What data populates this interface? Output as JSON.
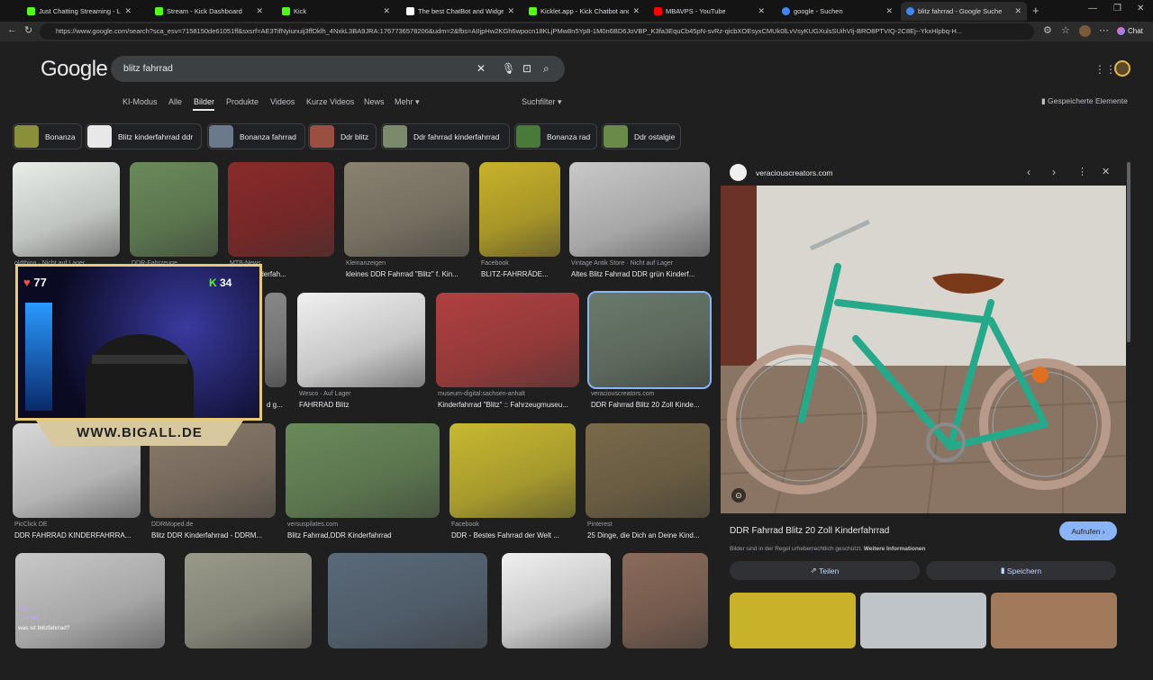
{
  "browser": {
    "tabs": [
      {
        "title": "Just Chatting Streaming - Live Stre",
        "color": "#53fc18"
      },
      {
        "title": "Stream - Kick Dashboard",
        "color": "#53fc18"
      },
      {
        "title": "Kick",
        "color": "#53fc18"
      },
      {
        "title": "The best ChatBot and Widgets fo",
        "color": "#ffffff"
      },
      {
        "title": "Kicklet.app - Kick Chatbot and Ov",
        "color": "#53fc18"
      },
      {
        "title": "MBAVPS - YouTube",
        "color": "#ff0000"
      },
      {
        "title": "google - Suchen",
        "color": "#4285f4"
      },
      {
        "title": "blitz fahrrad - Google Suche",
        "color": "#4285f4"
      }
    ],
    "url": "https://www.google.com/search?sca_esv=7158150de61051ff&sxsrf=AE3TifNyiunuij3ffDklh_4NxkL3BA9JRA:1767736578206&udm=2&fbs=AIIjpHw2KGh6wpocn18KLjPMw8n5Yp8-1M0n6BD6JoVBP_K3fa3EquCb45pN-svRz-qicbXOEsyxCMUk0lLvVsyKUGXulsSUihVIj-BRO8PTVIQ-2C8Ej--YkxHlpbq-H...",
    "chat_label": "Chat"
  },
  "google": {
    "logo": "Google",
    "query": "blitz fahrrad",
    "tabs": [
      "KI-Modus",
      "Alle",
      "Bilder",
      "Produkte",
      "Videos",
      "Kurze Videos",
      "News",
      "Mehr ▾"
    ],
    "filter": "Suchfilter ▾",
    "saved": "Gespeicherte Elemente",
    "chips": [
      {
        "label": "Bonanza",
        "color": "#8a8f3a"
      },
      {
        "label": "Blitz kinderfahrrad ddr",
        "color": "#e8e8e8"
      },
      {
        "label": "Bonanza fahrrad",
        "color": "#6b7a8a"
      },
      {
        "label": "Ddr blitz",
        "color": "#9a5040"
      },
      {
        "label": "Ddr fahrrad kinderfahrrad",
        "color": "#7a8a6a"
      },
      {
        "label": "Bonanza rad",
        "color": "#4a7a3a"
      },
      {
        "label": "Ddr ostalgie",
        "color": "#6a8a4a"
      }
    ]
  },
  "results": [
    {
      "src": "oldthing · Nicht auf Lager",
      "title": "",
      "color": "#e8ede8"
    },
    {
      "src": "DDR-Fahrzeuge",
      "title": "",
      "color": "#6a8a5a"
    },
    {
      "src": "MTB-News",
      "title": "2 Zoll Kinderfah...",
      "color": "#8a2a2a"
    },
    {
      "src": "Kleinanzeigen",
      "title": "kleines DDR Fahrrad \"Blitz\" f. Kin...",
      "color": "#8a8270"
    },
    {
      "src": "Facebook",
      "title": "BLITZ-FAHRRÄDE...",
      "color": "#c8b22a"
    },
    {
      "src": "Vintage Antik Store · Nicht auf Lager",
      "title": "Altes Blitz Fahrrad DDR grün Kinderf...",
      "color": "#c8c8c8"
    },
    {
      "src": "",
      "title": "d g...",
      "color": "#888888"
    },
    {
      "src": "Wesco · Auf Lager",
      "title": "FAHRRAD Blitz",
      "color": "#f0f0f0"
    },
    {
      "src": "museum-digital:sachsen-anhalt",
      "title": "Kinderfahrrad \"Blitz\" :: Fahrzeugmuseu...",
      "color": "#b04040"
    },
    {
      "src": "veraciouscreators.com",
      "title": "DDR Fahrrad Blitz 20 Zoll Kinde...",
      "color": "#6a7a6a"
    },
    {
      "src": "PicClick DE",
      "title": "DDR FAHRRAD KINDERFAHRRA...",
      "color": "#d8d8d8"
    },
    {
      "src": "DDRMoped.de",
      "title": "Blitz DDR Kinderfahrrad - DDRM...",
      "color": "#8a7a6a"
    },
    {
      "src": "versuspilates.com",
      "title": "Blitz Fahrrad,DDR Kinderfahrrad",
      "color": "#6a8a5a"
    },
    {
      "src": "Facebook",
      "title": "DDR - Bestes Fahrrad der Welt ...",
      "color": "#c8b830"
    },
    {
      "src": "Pinterest",
      "title": "25 Dinge, die Dich an Deine Kind...",
      "color": "#7a6a4a"
    },
    {
      "src": "",
      "title": "",
      "color": "#c8c8c8"
    },
    {
      "src": "",
      "title": "",
      "color": "#9a9a8a"
    },
    {
      "src": "",
      "title": "",
      "color": "#5a6a7a"
    },
    {
      "src": "",
      "title": "",
      "color": "#f0f0f0"
    },
    {
      "src": "",
      "title": "",
      "color": "#8a6a5a"
    }
  ],
  "panel": {
    "site": "veraciouscreators.com",
    "title": "DDR Fahrrad Blitz 20 Zoll Kinderfahrrad",
    "visit": "Aufrufen ›",
    "notice": "Bilder sind in der Regel urheberrechtlich geschützt.",
    "more": "Weitere Informationen",
    "share": "Teilen",
    "save": "Speichern"
  },
  "overlay": {
    "heart": "77",
    "kick": "34",
    "website": "WWW.BIGALL.DE",
    "chat": [
      "Kal...",
      "...ch pos",
      "was ist blitzfahrrad?"
    ]
  }
}
